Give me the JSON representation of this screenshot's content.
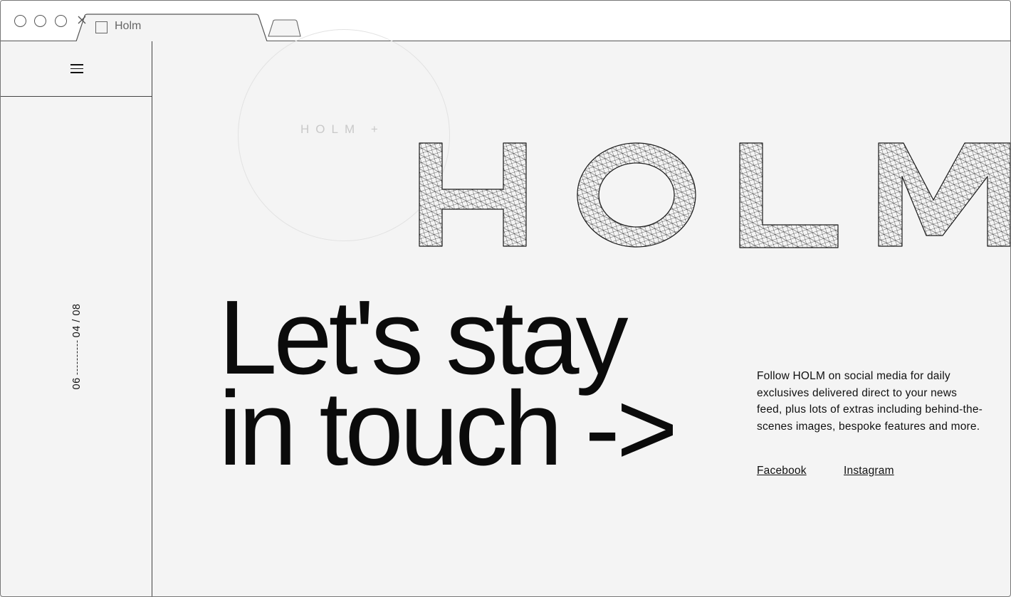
{
  "browser": {
    "tab_title": "Holm",
    "icons": [
      "close-window-dot",
      "minimize-window-dot",
      "maximize-window-dot",
      "favicon-placeholder-icon",
      "close-icon",
      "new-tab-icon"
    ]
  },
  "sidebar": {
    "menu_icon": "hamburger-icon",
    "pager": {
      "current": "06",
      "total": "04 / 08"
    }
  },
  "main": {
    "badge_text": "HOLM +",
    "wordmark": "HOLM",
    "headline_line1": "Let's stay",
    "headline_line2": "in touch ->",
    "description": "Follow HOLM on social media for daily exclusives delivered direct to your news feed, plus lots of extras including behind-the-scenes images, bespoke features and more.",
    "links": {
      "facebook": "Facebook",
      "instagram": "Instagram"
    }
  },
  "colors": {
    "background": "#f4f4f4",
    "text": "#0b0b0b",
    "muted": "#c9c9c9",
    "border": "#444444"
  }
}
